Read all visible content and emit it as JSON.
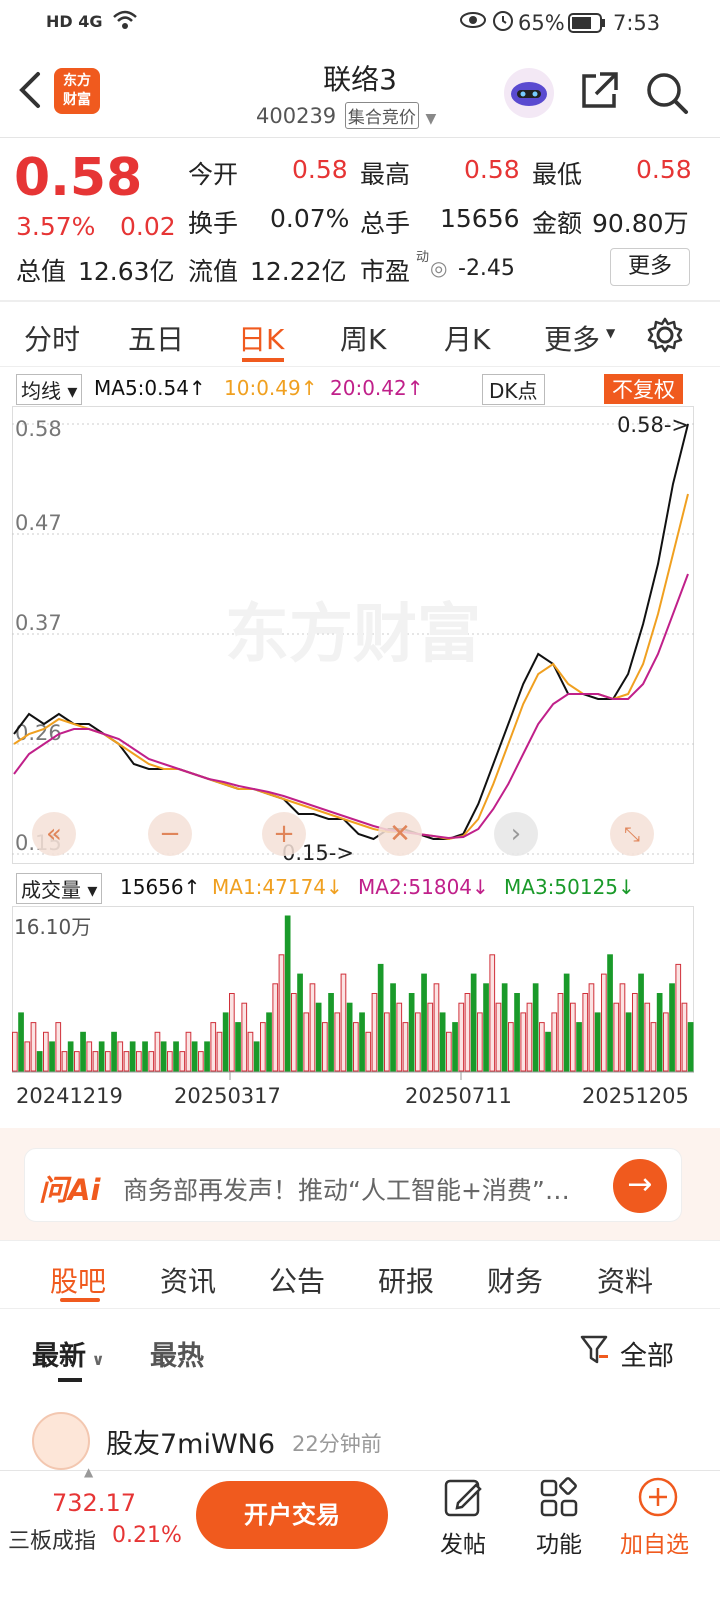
{
  "status": {
    "net": "HD 4G",
    "battery": "65%",
    "time": "7:53"
  },
  "header": {
    "logo_line1": "东方",
    "logo_line2": "财富",
    "title": "联络3",
    "code": "400239",
    "mode": "集合竞价"
  },
  "quote": {
    "price": "0.58",
    "pct": "3.57%",
    "change": "0.02",
    "open_label": "今开",
    "open": "0.58",
    "high_label": "最高",
    "high": "0.58",
    "low_label": "最低",
    "low": "0.58",
    "turnover_label": "换手",
    "turnover": "0.07%",
    "vol_label": "总手",
    "vol": "15656",
    "amt_label": "金额",
    "amt": "90.80万",
    "mcap_label": "总值",
    "mcap": "12.63亿",
    "float_label": "流值",
    "float": "12.22亿",
    "pe_label": "市盈",
    "pe_sup": "动",
    "pe": "-2.45",
    "more": "更多"
  },
  "tabs": [
    "分时",
    "五日",
    "日K",
    "周K",
    "月K",
    "更多"
  ],
  "tab_active": 2,
  "ma_legend": {
    "select": "均线",
    "ma5": "MA5:0.54↑",
    "ma10": "10:0.49↑",
    "ma20": "20:0.42↑",
    "dk": "DK点",
    "fq": "不复权"
  },
  "chart_data": {
    "type": "line",
    "title": "",
    "ylim": [
      0.15,
      0.58
    ],
    "y_ticks": [
      "0.58",
      "0.47",
      "0.37",
      "0.26",
      "0.15"
    ],
    "max_label": "0.58->",
    "min_label": "0.15->",
    "watermark": "东方财富",
    "series": [
      {
        "name": "MA5",
        "color": "#111111",
        "values": [
          0.27,
          0.29,
          0.28,
          0.29,
          0.28,
          0.28,
          0.27,
          0.26,
          0.24,
          0.235,
          0.235,
          0.235,
          0.23,
          0.225,
          0.22,
          0.215,
          0.215,
          0.21,
          0.205,
          0.19,
          0.19,
          0.185,
          0.185,
          0.17,
          0.165,
          0.175,
          0.175,
          0.17,
          0.165,
          0.165,
          0.17,
          0.2,
          0.24,
          0.28,
          0.32,
          0.35,
          0.34,
          0.31,
          0.31,
          0.305,
          0.305,
          0.33,
          0.38,
          0.44,
          0.52,
          0.58
        ]
      },
      {
        "name": "MA10",
        "color": "#f0a020",
        "values": [
          0.26,
          0.27,
          0.275,
          0.285,
          0.28,
          0.275,
          0.27,
          0.26,
          0.25,
          0.24,
          0.235,
          0.235,
          0.23,
          0.225,
          0.22,
          0.215,
          0.215,
          0.21,
          0.205,
          0.2,
          0.195,
          0.19,
          0.185,
          0.18,
          0.175,
          0.172,
          0.172,
          0.17,
          0.168,
          0.165,
          0.168,
          0.185,
          0.22,
          0.26,
          0.3,
          0.33,
          0.34,
          0.32,
          0.31,
          0.31,
          0.305,
          0.31,
          0.34,
          0.39,
          0.45,
          0.51
        ]
      },
      {
        "name": "MA20",
        "color": "#c0208a",
        "values": [
          0.23,
          0.25,
          0.26,
          0.27,
          0.275,
          0.275,
          0.27,
          0.265,
          0.255,
          0.245,
          0.24,
          0.235,
          0.23,
          0.225,
          0.222,
          0.218,
          0.215,
          0.212,
          0.208,
          0.203,
          0.198,
          0.193,
          0.188,
          0.183,
          0.178,
          0.174,
          0.172,
          0.17,
          0.168,
          0.166,
          0.167,
          0.175,
          0.195,
          0.22,
          0.25,
          0.28,
          0.3,
          0.31,
          0.31,
          0.31,
          0.305,
          0.305,
          0.32,
          0.35,
          0.39,
          0.43
        ]
      }
    ]
  },
  "vol_legend": {
    "select": "成交量",
    "vol": "15656↑",
    "ma1": "MA1:47174↓",
    "ma2": "MA2:51804↓",
    "ma3": "MA3:50125↓"
  },
  "volume_chart": {
    "max_label": "16.10万",
    "dates": [
      "20241219",
      "20250317",
      "20250711",
      "20251205"
    ],
    "bars": [
      4,
      6,
      3,
      5,
      2,
      4,
      3,
      5,
      2,
      3,
      2,
      4,
      3,
      2,
      3,
      2,
      4,
      3,
      2,
      3,
      2,
      3,
      2,
      4,
      3,
      2,
      3,
      2,
      4,
      3,
      2,
      3,
      5,
      4,
      6,
      8,
      5,
      7,
      4,
      3,
      5,
      6,
      9,
      12,
      16,
      8,
      10,
      6,
      9,
      7,
      5,
      8,
      6,
      10,
      7,
      5,
      6,
      4,
      8,
      11,
      6,
      9,
      7,
      5,
      8,
      6,
      10,
      7,
      9,
      6,
      4,
      5,
      7,
      8,
      10,
      6,
      9,
      12,
      7,
      9,
      5,
      8,
      6,
      7,
      9,
      5,
      4,
      6,
      8,
      10,
      7,
      5,
      8,
      9,
      6,
      10,
      12,
      7,
      9,
      6,
      8,
      10,
      7,
      5,
      8,
      6,
      9,
      11,
      7,
      5
    ],
    "colors": [
      "r",
      "g"
    ]
  },
  "ai": {
    "label": "问Ai",
    "text": "商务部再发声！推动“人工智能+消费”…"
  },
  "section_tabs": [
    "股吧",
    "资讯",
    "公告",
    "研报",
    "财务",
    "资料"
  ],
  "sub_tabs": {
    "latest": "最新",
    "hot": "最热",
    "filter": "全部"
  },
  "post": {
    "user": "股友7miWN6",
    "time": "22分钟前"
  },
  "bottom": {
    "index_value": "732.17",
    "index_name": "三板成指",
    "index_pct": "0.21%",
    "trade_btn": "开户交易",
    "post": "发帖",
    "func": "功能",
    "add": "加自选"
  }
}
